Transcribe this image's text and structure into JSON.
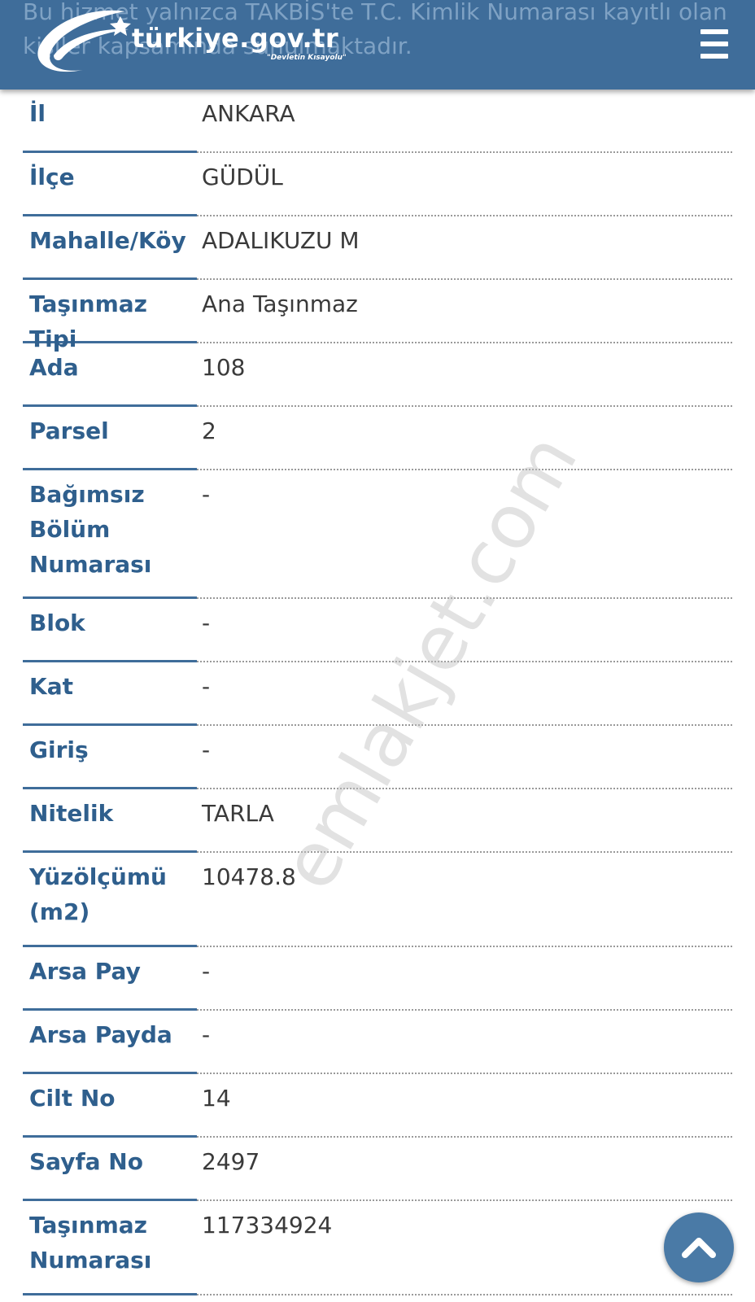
{
  "header": {
    "background_text": "Bu hizmet yalnızca TAKBİS'te T.C. Kimlik Numarası kayıtlı olan kişiler kapsamında sunulmaktadır.",
    "logo_text": "türkiye.gov.tr",
    "logo_tagline": "\"Devletin Kısayolu\"",
    "menu_icon": "hamburger-menu-icon",
    "color": "#3f6d9a"
  },
  "property": {
    "rows": [
      {
        "label": "İl",
        "value": "ANKARA"
      },
      {
        "label": "İlçe",
        "value": "GÜDÜL"
      },
      {
        "label": "Mahalle/Köy",
        "value": "ADALIKUZU M"
      },
      {
        "label": "Taşınmaz Tipi",
        "value": "Ana Taşınmaz"
      },
      {
        "label": "Ada",
        "value": "108"
      },
      {
        "label": "Parsel",
        "value": "2"
      },
      {
        "label": "Bağımsız Bölüm Numarası",
        "value": "-"
      },
      {
        "label": "Blok",
        "value": "-"
      },
      {
        "label": "Kat",
        "value": "-"
      },
      {
        "label": "Giriş",
        "value": "-"
      },
      {
        "label": "Nitelik",
        "value": "TARLA"
      },
      {
        "label": "Yüzölçümü (m2)",
        "value": "10478.8"
      },
      {
        "label": "Arsa Pay",
        "value": "-"
      },
      {
        "label": "Arsa Payda",
        "value": "-"
      },
      {
        "label": "Cilt No",
        "value": "14"
      },
      {
        "label": "Sayfa No",
        "value": "2497"
      },
      {
        "label": "Taşınmaz Numarası",
        "value": "117334924"
      }
    ],
    "label_color": "#2f5f8d",
    "value_color": "#3a3a3a"
  },
  "watermark": "emlakjet.com",
  "scroll_top_icon": "chevron-up-icon"
}
